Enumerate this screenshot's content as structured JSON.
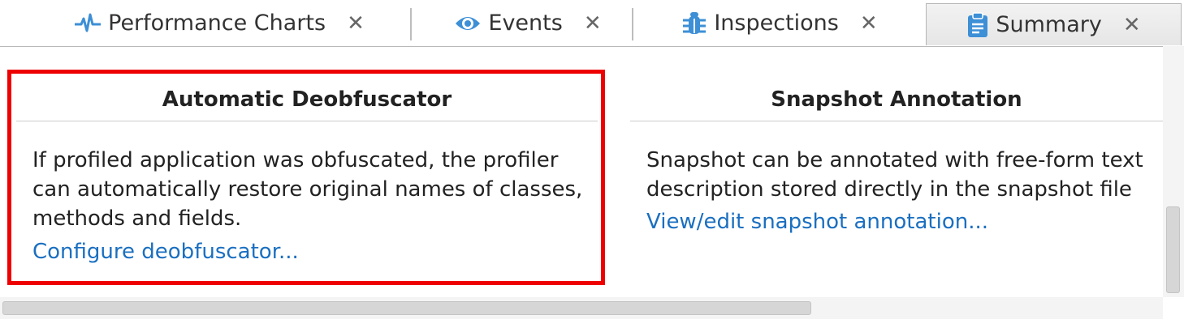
{
  "tabs": [
    {
      "label": "Performance Charts",
      "icon": "pulse-icon",
      "close": "✕"
    },
    {
      "label": "Events",
      "icon": "eye-icon",
      "close": "✕"
    },
    {
      "label": "Inspections",
      "icon": "bug-icon",
      "close": "✕"
    },
    {
      "label": "Summary",
      "icon": "clipboard-icon",
      "close": "✕",
      "active": true
    }
  ],
  "panels": {
    "deobfuscator": {
      "title": "Automatic Deobfuscator",
      "body": [
        "If profiled application was obfuscated, the profiler",
        "can automatically restore original names of classes,",
        "methods and fields."
      ],
      "link": "Configure deobfuscator..."
    },
    "annotation": {
      "title": "Snapshot Annotation",
      "body": [
        "Snapshot can be annotated with free-form text",
        "description stored directly in the snapshot file"
      ],
      "link": "View/edit snapshot annotation..."
    }
  },
  "colors": {
    "accent_blue": "#3d8fd6",
    "link": "#1a6fc0",
    "highlight": "#ee0000"
  }
}
